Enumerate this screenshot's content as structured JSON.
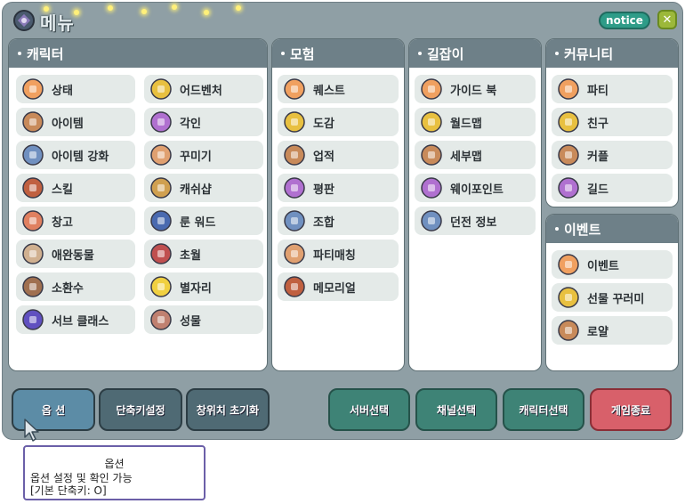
{
  "app": {
    "title": "메뉴"
  },
  "header": {
    "notice_label": "notice",
    "close_label": "✕"
  },
  "panels": {
    "character": {
      "title": "캐릭터",
      "items": [
        {
          "label": "상태",
          "icon": "status-icon"
        },
        {
          "label": "어드벤처",
          "icon": "adventure-icon"
        },
        {
          "label": "아이템",
          "icon": "item-bag-icon"
        },
        {
          "label": "각인",
          "icon": "engraving-icon"
        },
        {
          "label": "아이템 강화",
          "icon": "enhance-icon"
        },
        {
          "label": "꾸미기",
          "icon": "decorate-icon"
        },
        {
          "label": "스킬",
          "icon": "skill-book-icon"
        },
        {
          "label": "캐쉬샵",
          "icon": "cash-shop-icon"
        },
        {
          "label": "창고",
          "icon": "storage-icon"
        },
        {
          "label": "룬 워드",
          "icon": "rune-word-icon"
        },
        {
          "label": "애완동물",
          "icon": "pet-icon"
        },
        {
          "label": "초월",
          "icon": "transcend-icon"
        },
        {
          "label": "소환수",
          "icon": "summon-icon"
        },
        {
          "label": "별자리",
          "icon": "star-icon"
        },
        {
          "label": "서브 클래스",
          "icon": "subclass-icon"
        },
        {
          "label": "성물",
          "icon": "relic-icon"
        }
      ]
    },
    "adventure": {
      "title": "모험",
      "items": [
        {
          "label": "퀘스트",
          "icon": "quest-scroll-icon"
        },
        {
          "label": "도감",
          "icon": "codex-book-icon"
        },
        {
          "label": "업적",
          "icon": "trophy-icon"
        },
        {
          "label": "평판",
          "icon": "reputation-medal-icon"
        },
        {
          "label": "조합",
          "icon": "combine-gear-icon"
        },
        {
          "label": "파티매칭",
          "icon": "party-matching-icon"
        },
        {
          "label": "메모리얼",
          "icon": "memorial-icon"
        }
      ]
    },
    "guide": {
      "title": "길잡이",
      "items": [
        {
          "label": "가이드 북",
          "icon": "guide-book-icon"
        },
        {
          "label": "월드맵",
          "icon": "world-map-icon"
        },
        {
          "label": "세부맵",
          "icon": "detail-map-icon"
        },
        {
          "label": "웨이포인트",
          "icon": "waypoint-orb-icon"
        },
        {
          "label": "던전 정보",
          "icon": "dungeon-info-icon"
        }
      ]
    },
    "community": {
      "title": "커뮤니티",
      "items": [
        {
          "label": "파티",
          "icon": "party-icon"
        },
        {
          "label": "친구",
          "icon": "friend-icon"
        },
        {
          "label": "커플",
          "icon": "couple-icon"
        },
        {
          "label": "길드",
          "icon": "guild-icon"
        }
      ]
    },
    "event": {
      "title": "이벤트",
      "items": [
        {
          "label": "이벤트",
          "icon": "event-bouquet-icon"
        },
        {
          "label": "선물 꾸러미",
          "icon": "gift-box-icon"
        },
        {
          "label": "로얄",
          "icon": "royal-icon"
        }
      ]
    }
  },
  "bottom": {
    "options": "옵 션",
    "hotkeys": "단축키설정",
    "reset_window": "창위치 초기화",
    "server_select": "서버선택",
    "channel_select": "채널선택",
    "character_select": "캐릭터선택",
    "quit_game": "게임종료"
  },
  "tooltip": {
    "title": "옵션",
    "line1": "옵션 설정 및 확인 가능",
    "line2": "[기본 단축키: O]"
  }
}
